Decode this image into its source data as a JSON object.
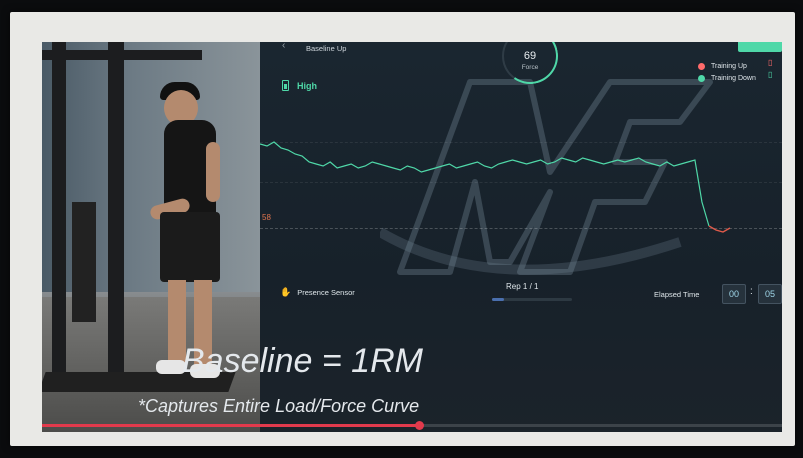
{
  "app": {
    "baseline_up": "Baseline Up",
    "force_value": "69",
    "force_label": "Force",
    "top_button": "",
    "battery_label": "High",
    "legend": [
      {
        "label": "Training Up",
        "color": "#ff6b6b"
      },
      {
        "label": "Training Down",
        "color": "#4fd8a8"
      }
    ],
    "y_tick": "58",
    "presence_label": "Presence Sensor",
    "rep_text": "Rep  1  /  1",
    "rep_progress": 0.15,
    "elapsed_label": "Elapsed Time",
    "time_min": "00",
    "time_sec": "05"
  },
  "captions": {
    "main": "Baseline = 1RM",
    "sub": "*Captures Entire Load/Force Curve"
  },
  "video": {
    "progress": 0.51
  },
  "chart_data": {
    "type": "line",
    "series": [
      {
        "name": "Training Down",
        "color": "#4fd8a8",
        "values": [
          69,
          68,
          70,
          67,
          66,
          64,
          63,
          60,
          59,
          58,
          60,
          57,
          58,
          59,
          57,
          58,
          60,
          59,
          58,
          57,
          56,
          58,
          57,
          55,
          56,
          57,
          58,
          59,
          57,
          58,
          59,
          60,
          58,
          57,
          59,
          60,
          61,
          60,
          59,
          60,
          61,
          59,
          60,
          62,
          61,
          60,
          62,
          61,
          60,
          59,
          60,
          61,
          60,
          61,
          62,
          60,
          59,
          58,
          60,
          58,
          59,
          60,
          61,
          40,
          28,
          26,
          25,
          27
        ]
      },
      {
        "name": "Training Up",
        "color": "#ff6b6b",
        "values": []
      }
    ],
    "ylim": [
      15,
      85
    ],
    "reference_y": 25
  }
}
